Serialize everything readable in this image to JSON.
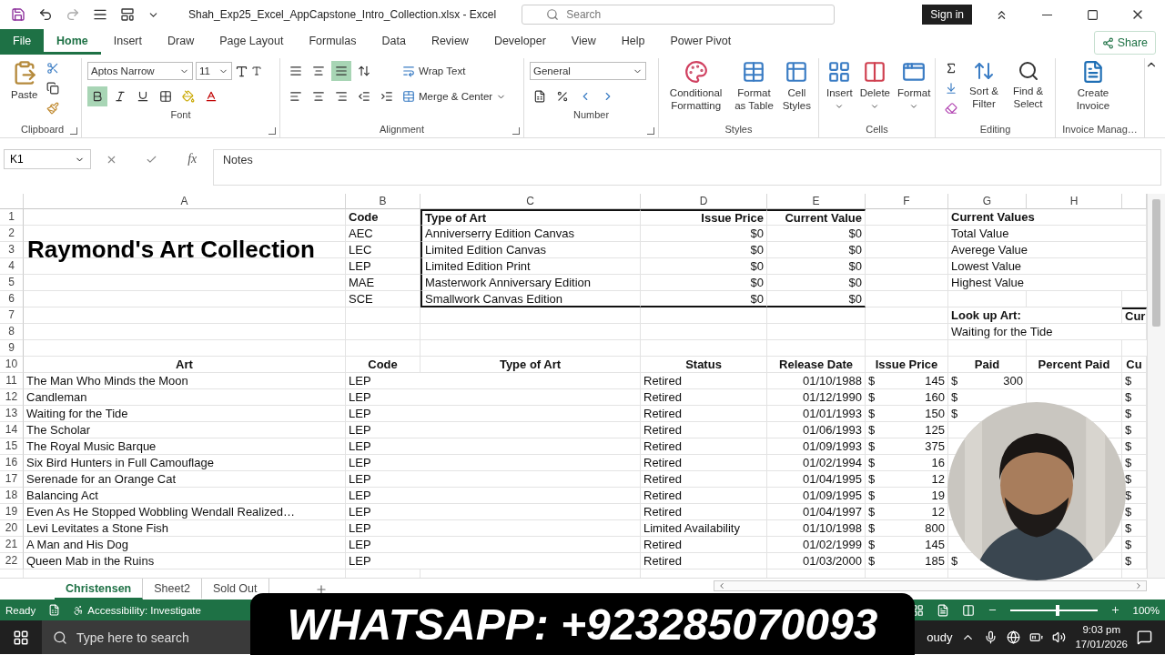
{
  "title_bar": {
    "filename": "Shah_Exp25_Excel_AppCapstone_Intro_Collection.xlsx  -  Excel",
    "search_placeholder": "Search",
    "sign_in": "Sign in"
  },
  "menu_tabs": [
    {
      "label": "File",
      "kind": "file",
      "selected": false
    },
    {
      "label": "Home",
      "kind": "tab",
      "selected": true
    },
    {
      "label": "Insert",
      "kind": "tab",
      "selected": false
    },
    {
      "label": "Draw",
      "kind": "tab",
      "selected": false
    },
    {
      "label": "Page Layout",
      "kind": "tab",
      "selected": false
    },
    {
      "label": "Formulas",
      "kind": "tab",
      "selected": false
    },
    {
      "label": "Data",
      "kind": "tab",
      "selected": false
    },
    {
      "label": "Review",
      "kind": "tab",
      "selected": false
    },
    {
      "label": "Developer",
      "kind": "tab",
      "selected": false
    },
    {
      "label": "View",
      "kind": "tab",
      "selected": false
    },
    {
      "label": "Help",
      "kind": "tab",
      "selected": false
    },
    {
      "label": "Power Pivot",
      "kind": "tab",
      "selected": false
    }
  ],
  "share": "Share",
  "ribbon": {
    "clipboard": {
      "name": "Clipboard",
      "paste": "Paste"
    },
    "font": {
      "name": "Font",
      "font": "Aptos Narrow",
      "size": "11",
      "bold": true,
      "italic": false,
      "underline": false
    },
    "alignment": {
      "name": "Alignment",
      "align_top": false,
      "align_middle": false,
      "align_bottom": true,
      "wrap": "Wrap Text",
      "merge": "Merge & Center"
    },
    "number": {
      "name": "Number",
      "format": "General"
    },
    "styles": {
      "name": "Styles",
      "buttons": [
        "Conditional Formatting",
        "Format as Table",
        "Cell Styles"
      ]
    },
    "cells": {
      "name": "Cells",
      "buttons": [
        "Insert",
        "Delete",
        "Format"
      ]
    },
    "editing": {
      "name": "Editing",
      "buttons": [
        "Sort & Filter",
        "Find & Select"
      ]
    },
    "invoice": {
      "name": "Invoice Manag…",
      "buttons": [
        "Create Invoice"
      ]
    }
  },
  "formula_bar": {
    "name_box": "K1",
    "fx_label": "fx",
    "formula": "Notes"
  },
  "sheet": {
    "columns": [
      "A",
      "B",
      "C",
      "D",
      "E",
      "F",
      "G",
      "H"
    ],
    "title": "Raymond's Art Collection",
    "rows": [
      {
        "number": "1",
        "kind": "head",
        "cells": [
          null,
          "Code",
          "Type of Art",
          "Issue Price",
          "Current Value",
          null,
          "Current Values",
          null,
          null
        ]
      },
      {
        "number": "2",
        "kind": "summary",
        "cells": [
          null,
          "AEC",
          "Anniverserry Edition Canvas",
          "$0",
          "$0",
          null,
          "Total Value",
          null,
          null
        ]
      },
      {
        "number": "3",
        "kind": "summary",
        "cells": [
          null,
          "LEC",
          "Limited Edition Canvas",
          "$0",
          "$0",
          null,
          "Averege Value",
          null,
          null
        ]
      },
      {
        "number": "4",
        "kind": "summary",
        "cells": [
          null,
          "LEP",
          "Limited Edition Print",
          "$0",
          "$0",
          null,
          "Lowest Value",
          null,
          null
        ]
      },
      {
        "number": "5",
        "kind": "summary",
        "cells": [
          null,
          "MAE",
          "Masterwork Anniversary Edition",
          "$0",
          "$0",
          null,
          "Highest Value",
          null,
          null
        ]
      },
      {
        "number": "6",
        "kind": "summary",
        "cells": [
          null,
          "SCE",
          "Smallwork Canvas Edition",
          "$0",
          "$0",
          null,
          null,
          null,
          null
        ]
      },
      {
        "number": "7",
        "kind": "head",
        "cells": [
          null,
          null,
          null,
          null,
          null,
          null,
          "Look up Art:",
          null,
          "Cur"
        ]
      },
      {
        "number": "8",
        "kind": "summary",
        "cells": [
          null,
          null,
          null,
          null,
          null,
          null,
          "Waiting for the Tide",
          null,
          null
        ]
      },
      {
        "number": "9",
        "kind": "summary",
        "cells": [
          null,
          null,
          null,
          null,
          null,
          null,
          null,
          null,
          null
        ]
      },
      {
        "number": "10",
        "kind": "header",
        "cells": [
          "Art",
          "Code",
          "Type of Art",
          "Status",
          "Release Date",
          "Issue Price",
          "Paid",
          "Percent Paid",
          "Cu"
        ]
      },
      {
        "number": "11",
        "kind": "record",
        "cells": [
          "The Man Who Minds the Moon",
          "LEP",
          null,
          "Retired",
          "01/10/1988",
          {
            "symbol": "$",
            "amount": "145"
          },
          {
            "symbol": "$",
            "amount": "300"
          },
          null,
          {
            "symbol": "$"
          }
        ]
      },
      {
        "number": "12",
        "kind": "record",
        "cells": [
          "Candleman",
          "LEP",
          null,
          "Retired",
          "01/12/1990",
          {
            "symbol": "$",
            "amount": "160"
          },
          {
            "symbol": "$"
          },
          null,
          {
            "symbol": "$"
          }
        ]
      },
      {
        "number": "13",
        "kind": "record",
        "cells": [
          "Waiting for the Tide",
          "LEP",
          null,
          "Retired",
          "01/01/1993",
          {
            "symbol": "$",
            "amount": "150"
          },
          {
            "symbol": "$"
          },
          null,
          {
            "symbol": "$"
          }
        ]
      },
      {
        "number": "14",
        "kind": "record",
        "cells": [
          "The Scholar",
          "LEP",
          null,
          "Retired",
          "01/06/1993",
          {
            "symbol": "$",
            "amount": "125"
          },
          null,
          null,
          {
            "symbol": "$"
          }
        ]
      },
      {
        "number": "15",
        "kind": "record",
        "cells": [
          "The Royal Music Barque",
          "LEP",
          null,
          "Retired",
          "01/09/1993",
          {
            "symbol": "$",
            "amount": "375"
          },
          null,
          null,
          {
            "symbol": "$"
          }
        ]
      },
      {
        "number": "16",
        "kind": "record",
        "cells": [
          "Six Bird Hunters in Full Camouflage",
          "LEP",
          null,
          "Retired",
          "01/02/1994",
          {
            "symbol": "$",
            "amount": "16"
          },
          null,
          null,
          {
            "symbol": "$"
          }
        ]
      },
      {
        "number": "17",
        "kind": "record",
        "cells": [
          "Serenade for an Orange Cat",
          "LEP",
          null,
          "Retired",
          "01/04/1995",
          {
            "symbol": "$",
            "amount": "12"
          },
          null,
          null,
          {
            "symbol": "$"
          }
        ]
      },
      {
        "number": "18",
        "kind": "record",
        "cells": [
          "Balancing Act",
          "LEP",
          null,
          "Retired",
          "01/09/1995",
          {
            "symbol": "$",
            "amount": "19"
          },
          null,
          null,
          {
            "symbol": "$"
          }
        ]
      },
      {
        "number": "19",
        "kind": "record",
        "cells": [
          "Even As He Stopped Wobbling Wendall Realized…",
          "LEP",
          null,
          "Retired",
          "01/04/1997",
          {
            "symbol": "$",
            "amount": "12"
          },
          null,
          null,
          {
            "symbol": "$"
          }
        ]
      },
      {
        "number": "20",
        "kind": "record",
        "cells": [
          "Levi Levitates a Stone Fish",
          "LEP",
          null,
          "Limited Availability",
          "01/10/1998",
          {
            "symbol": "$",
            "amount": "800"
          },
          null,
          null,
          {
            "symbol": "$"
          }
        ]
      },
      {
        "number": "21",
        "kind": "record",
        "cells": [
          "A Man and His Dog",
          "LEP",
          null,
          "Retired",
          "01/02/1999",
          {
            "symbol": "$",
            "amount": "145"
          },
          null,
          null,
          {
            "symbol": "$"
          }
        ]
      },
      {
        "number": "22",
        "kind": "record",
        "cells": [
          "Queen Mab in the Ruins",
          "LEP",
          null,
          "Retired",
          "01/03/2000",
          {
            "symbol": "$",
            "amount": "185"
          },
          {
            "symbol": "$"
          },
          null,
          {
            "symbol": "$"
          }
        ]
      }
    ]
  },
  "sheet_tabs": [
    {
      "label": "Christensen",
      "selected": true
    },
    {
      "label": "Sheet2",
      "selected": false
    },
    {
      "label": "Sold Out",
      "selected": false
    }
  ],
  "status_bar": {
    "ready": "Ready",
    "accessibility": "Accessibility: Investigate",
    "zoom": "100%",
    "zoom_slider": {
      "level": 0.55
    }
  },
  "taskbar": {
    "search_placeholder": "Type here to search",
    "weather": "oudy",
    "time": "9:03 pm",
    "date": "17/01/2026"
  },
  "overlay_banner": {
    "text": "WHATSAPP: +923285070093"
  }
}
